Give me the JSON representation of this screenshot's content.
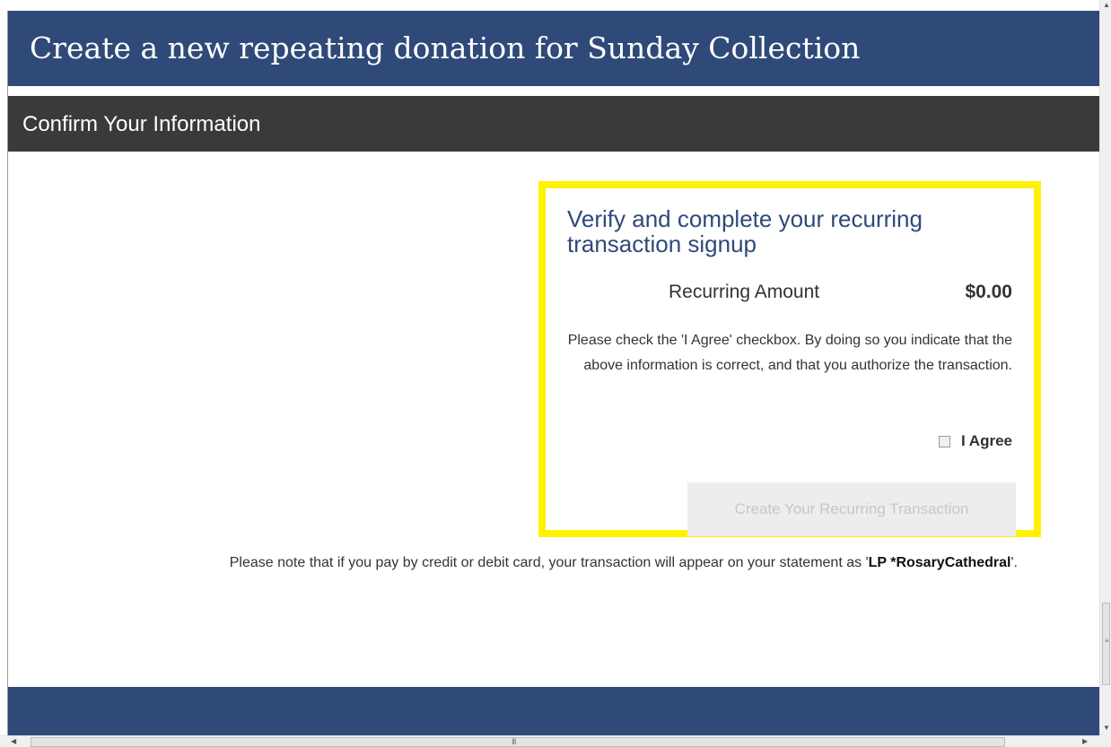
{
  "header": {
    "title": "Create a new repeating donation for Sunday Collection"
  },
  "section": {
    "title": "Confirm Your Information"
  },
  "verify": {
    "heading": "Verify and complete your recurring transaction signup",
    "amount_label": "Recurring Amount",
    "amount_value": "$0.00",
    "agree_text": "Please check the 'I Agree' checkbox. By doing so you indicate that the above information is correct, and that you authorize the transaction.",
    "agree_label": "I Agree",
    "agree_checked": false,
    "submit_label": "Create Your Recurring Transaction",
    "submit_enabled": false
  },
  "note": {
    "prefix": "Please note that if you pay by credit or debit card, your transaction will appear on your statement as '",
    "descriptor": "LP *RosaryCathedral",
    "suffix": "'."
  },
  "scrollbars": {
    "vertical_up_icon": "arrow-up-icon",
    "vertical_down_icon": "arrow-down-icon",
    "horizontal_left_icon": "arrow-left-icon",
    "horizontal_right_icon": "arrow-right-icon"
  },
  "colors": {
    "header_bg": "#2f4a79",
    "section_bg": "#3a3a3a",
    "highlight_border": "#fff200",
    "heading_text": "#2f4a79",
    "disabled_button_bg": "#ededed",
    "disabled_button_text": "#c7c7c7"
  }
}
